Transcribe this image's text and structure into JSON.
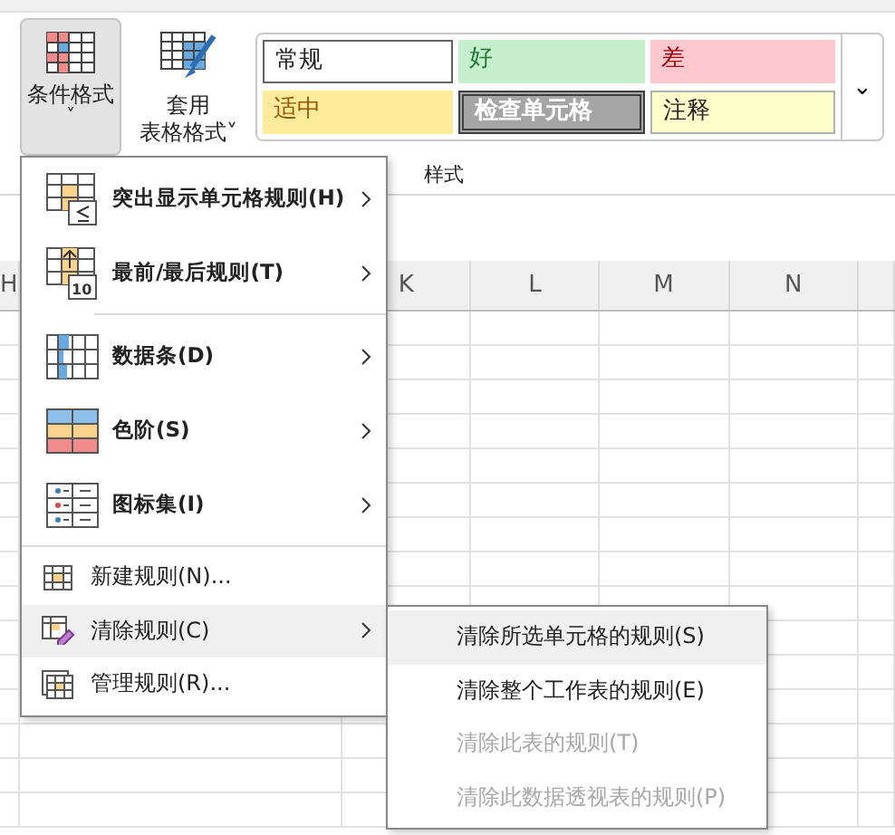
{
  "ribbon": {
    "buttons": [
      {
        "kind": "conditional",
        "lines": [
          "条件格式"
        ],
        "caret": "˅",
        "selected": true
      },
      {
        "kind": "table",
        "lines": [
          "套用",
          "表格格式"
        ],
        "caret": "˅",
        "selected": false
      }
    ],
    "styles": [
      {
        "label": "常规",
        "kind": "normal"
      },
      {
        "label": "好",
        "kind": "good"
      },
      {
        "label": "差",
        "kind": "bad"
      },
      {
        "label": "适中",
        "kind": "neutral"
      },
      {
        "label": "检查单元格",
        "kind": "check"
      },
      {
        "label": "注释",
        "kind": "note"
      }
    ],
    "more": "⌄",
    "group_label": "样式"
  },
  "sheet": {
    "columns": [
      "H",
      "",
      "K",
      "L",
      "M",
      "N",
      ""
    ]
  },
  "menu": {
    "items": [
      {
        "label": "突出显示单元格规则(H)",
        "kind": "highlight",
        "submenu": true,
        "selected": false
      },
      {
        "label": "最前/最后规则(T)",
        "kind": "top",
        "icon_label": "10",
        "submenu": true,
        "selected": false
      },
      {
        "label": "数据条(D)",
        "kind": "databar",
        "submenu": true,
        "selected": false
      },
      {
        "label": "色阶(S)",
        "kind": "colorscale",
        "submenu": true,
        "selected": false
      },
      {
        "label": "图标集(I)",
        "kind": "iconset",
        "submenu": true,
        "selected": false
      },
      {
        "label": "新建规则(N)...",
        "kind": "new",
        "submenu": false,
        "selected": false
      },
      {
        "label": "清除规则(C)",
        "kind": "clear",
        "submenu": true,
        "selected": true
      },
      {
        "label": "管理规则(R)...",
        "kind": "manage",
        "submenu": false,
        "selected": false
      }
    ]
  },
  "submenu": {
    "items": [
      {
        "label": "清除所选单元格的规则(S)",
        "disabled": false,
        "selected": true
      },
      {
        "label": "清除整个工作表的规则(E)",
        "disabled": false,
        "selected": false
      },
      {
        "label": "清除此表的规则(T)",
        "disabled": true,
        "selected": false
      },
      {
        "label": "清除此数据透视表的规则(P)",
        "disabled": true,
        "selected": false
      }
    ]
  }
}
